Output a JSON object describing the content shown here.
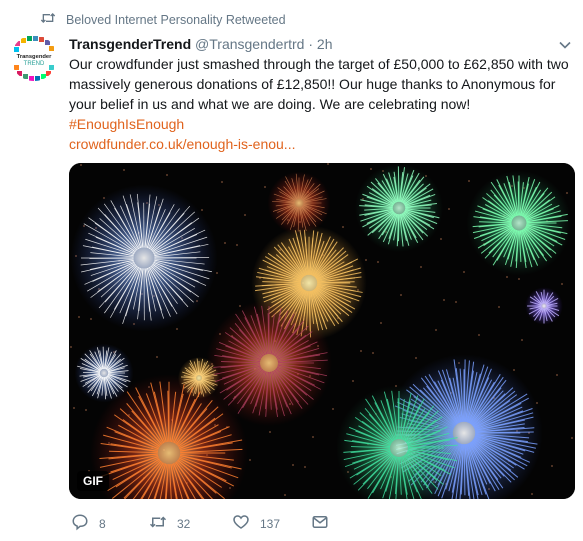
{
  "retweet_notice": {
    "text": "Beloved Internet Personality Retweeted"
  },
  "author": {
    "display_name": "TransgenderTrend",
    "handle": "@Transgendertrd",
    "separator": "·",
    "time": "2h",
    "avatar_text_top": "Transgender",
    "avatar_text_bottom": "TREND"
  },
  "tweet": {
    "body": "Our crowdfunder just smashed through the target of £50,000 to £62,850 with two massively generous donations of £12,850!! Our huge thanks to Anonymous for your belief in us and what we are doing. We are celebrating now!",
    "hashtag": "#EnoughIsEnough",
    "link": "crowdfunder.co.uk/enough-is-enou..."
  },
  "media": {
    "badge": "GIF"
  },
  "actions": {
    "replies": "8",
    "retweets": "32",
    "likes": "137"
  },
  "colors": {
    "link": "#e0631d",
    "muted": "#657786"
  }
}
